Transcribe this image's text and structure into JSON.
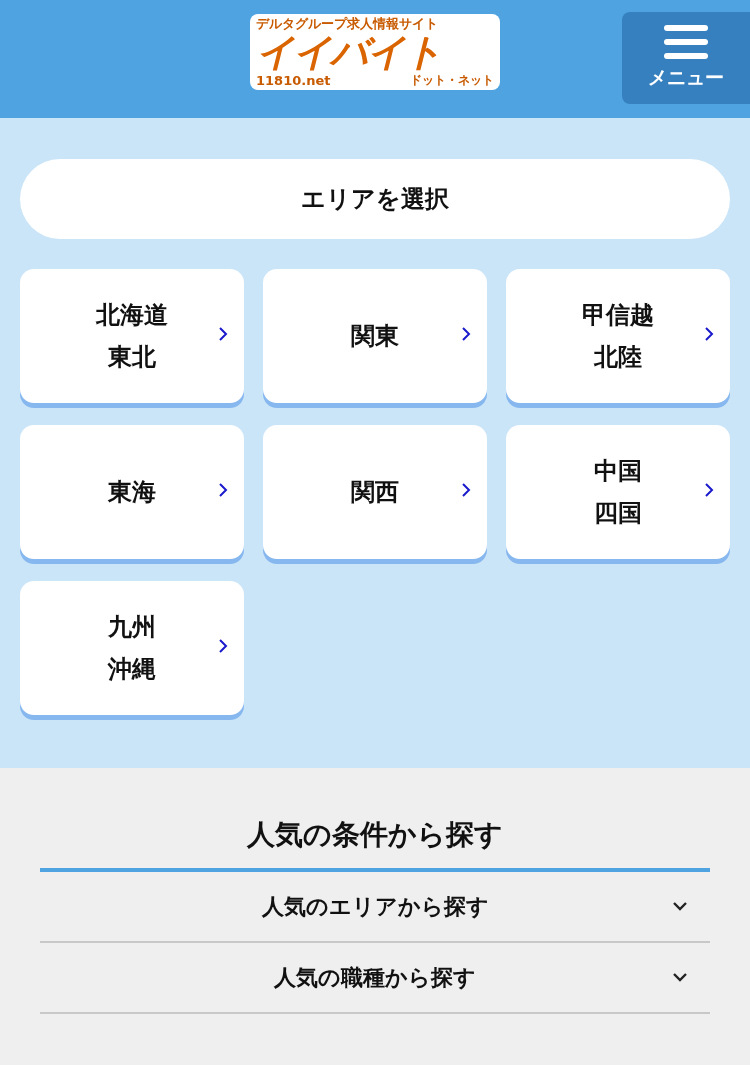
{
  "header": {
    "logo": {
      "tagline": "デルタグループ求人情報サイト",
      "name": "イイバイト",
      "domain": "11810.net",
      "reading": "ドット・ネット"
    },
    "menu_button": {
      "label": "メニュー"
    }
  },
  "area": {
    "select_button": "エリアを選択",
    "regions": [
      {
        "lines": [
          "北海道",
          "東北"
        ]
      },
      {
        "lines": [
          "関東"
        ]
      },
      {
        "lines": [
          "甲信越",
          "北陸"
        ]
      },
      {
        "lines": [
          "東海"
        ]
      },
      {
        "lines": [
          "関西"
        ]
      },
      {
        "lines": [
          "中国",
          "四国"
        ]
      },
      {
        "lines": [
          "九州",
          "沖縄"
        ]
      }
    ]
  },
  "popular": {
    "title": "人気の条件から探す",
    "items": [
      {
        "label": "人気のエリアから探す",
        "expanded": false
      },
      {
        "label": "人気の職種から探す",
        "expanded": false
      }
    ]
  }
}
